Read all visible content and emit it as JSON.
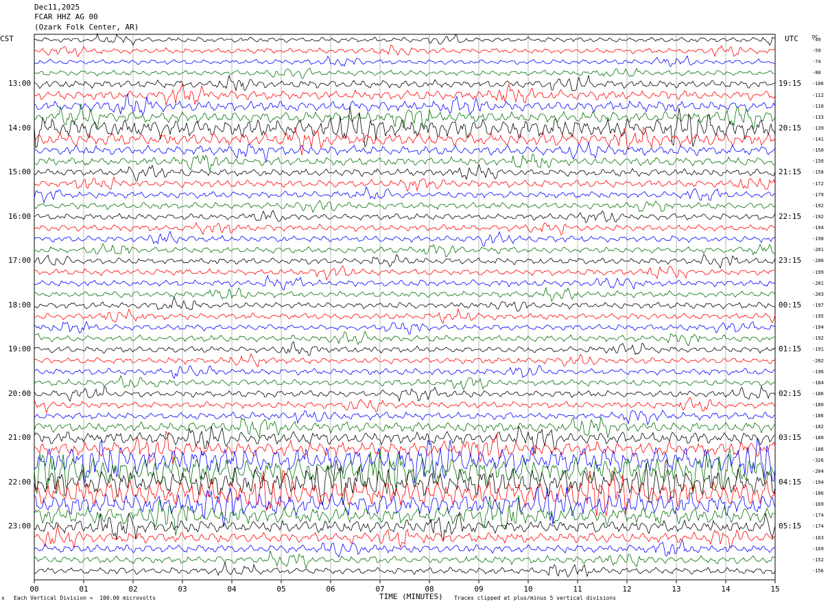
{
  "header": {
    "date": "Dec11,2025",
    "station": "FCAR HHZ AG 00",
    "location": "(Ozark Folk Center, AR)"
  },
  "left_tz": "CST",
  "right_tz": "UTC",
  "dc_label": "DC",
  "footer": {
    "left_mark": "∧",
    "scale": "Each Vertical Division =  100.00 microvolts",
    "clip": "Traces clipped at plus/minus 5 vertical divisions"
  },
  "chart_data": {
    "type": "line",
    "title": "FCAR HHZ AG 00",
    "xlabel": "TIME (MINUTES)",
    "ylabel": "",
    "xlim": [
      0,
      15
    ],
    "x_ticks": [
      "00",
      "01",
      "02",
      "03",
      "04",
      "05",
      "06",
      "07",
      "08",
      "09",
      "10",
      "11",
      "12",
      "13",
      "14",
      "15"
    ],
    "trace_minutes": 15,
    "trace_colors": [
      "#000000",
      "#ff0000",
      "#0000ff",
      "#007000"
    ],
    "left_hour_labels": [
      "13:00",
      "14:00",
      "15:00",
      "16:00",
      "17:00",
      "18:00",
      "19:00",
      "20:00",
      "21:00",
      "22:00",
      "23:00"
    ],
    "right_hour_labels": [
      "19:15",
      "20:15",
      "21:15",
      "22:15",
      "23:15",
      "00:15",
      "01:15",
      "02:15",
      "03:15",
      "04:15",
      "05:15"
    ],
    "dc_offsets": [
      -49,
      -59,
      -74,
      -80,
      -106,
      -112,
      -110,
      -133,
      -139,
      -141,
      -150,
      -150,
      -158,
      -172,
      -179,
      -192,
      -192,
      -194,
      -198,
      -201,
      -200,
      -199,
      -201,
      -203,
      -197,
      -195,
      -194,
      -192,
      -191,
      -202,
      -196,
      -184,
      -186,
      -180,
      -186,
      -182,
      -180,
      -186,
      -326,
      -204,
      -194,
      -186,
      -169,
      -174,
      -174,
      -163,
      -169,
      -152,
      -156
    ],
    "trace_activity": [
      {
        "level": 1.2
      },
      {
        "level": 1.3
      },
      {
        "level": 1.2
      },
      {
        "level": 1.3
      },
      {
        "level": 1.8
      },
      {
        "level": 2.2
      },
      {
        "level": 2.4
      },
      {
        "level": 2.6
      },
      {
        "level": 4.5
      },
      {
        "level": 3.0
      },
      {
        "level": 2.2
      },
      {
        "level": 2.0
      },
      {
        "level": 1.8
      },
      {
        "level": 1.7
      },
      {
        "level": 1.6
      },
      {
        "level": 1.6
      },
      {
        "level": 1.5
      },
      {
        "level": 1.5
      },
      {
        "level": 1.5
      },
      {
        "level": 1.5
      },
      {
        "level": 1.5
      },
      {
        "level": 1.5
      },
      {
        "level": 1.5
      },
      {
        "level": 1.5
      },
      {
        "level": 1.5
      },
      {
        "level": 1.5
      },
      {
        "level": 1.5
      },
      {
        "level": 1.5
      },
      {
        "level": 1.5
      },
      {
        "level": 1.5
      },
      {
        "level": 1.5
      },
      {
        "level": 1.5
      },
      {
        "level": 1.6
      },
      {
        "level": 1.6
      },
      {
        "level": 1.7
      },
      {
        "level": 2.4
      },
      {
        "level": 3.0
      },
      {
        "level": 3.5
      },
      {
        "level": 6.0
      },
      {
        "level": 6.5
      },
      {
        "level": 6.5
      },
      {
        "level": 6.0
      },
      {
        "level": 5.0
      },
      {
        "level": 4.0
      },
      {
        "level": 3.0
      },
      {
        "level": 2.5
      },
      {
        "level": 2.0
      },
      {
        "level": 1.8
      },
      {
        "level": 1.6
      }
    ]
  }
}
